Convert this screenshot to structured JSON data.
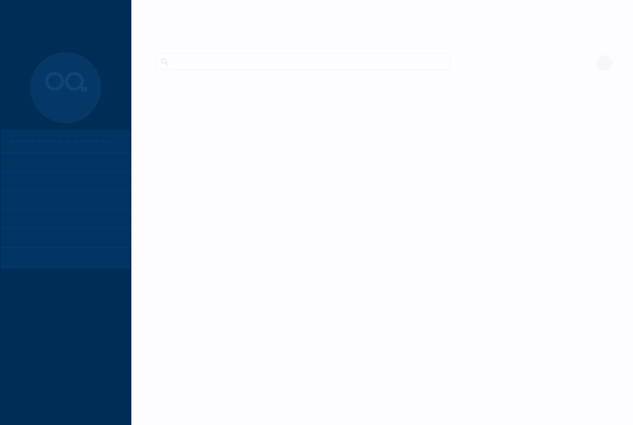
{
  "sidebar": {
    "logo": {
      "icon": "co-logo-icon",
      "color": "#1a4a7a"
    },
    "nav_items": [
      {
        "label": "",
        "icon": "menu-item"
      },
      {
        "label": "",
        "icon": "menu-item"
      },
      {
        "label": "",
        "icon": "menu-item"
      },
      {
        "label": "",
        "icon": "menu-item"
      },
      {
        "label": "",
        "icon": "menu-item"
      },
      {
        "label": "",
        "icon": "menu-item"
      },
      {
        "label": "",
        "icon": "menu-item"
      }
    ]
  },
  "header": {
    "search": {
      "placeholder": "",
      "icon": "search-icon"
    },
    "avatar": {
      "icon": "user-avatar-icon"
    }
  },
  "colors": {
    "sidebar_bg": "#002d56",
    "nav_bg": "#013363",
    "main_bg": "#fdfcff"
  }
}
